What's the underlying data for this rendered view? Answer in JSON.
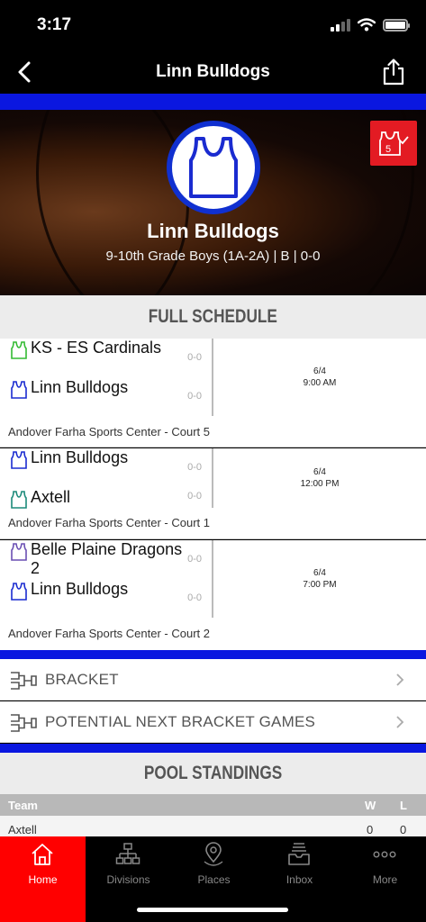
{
  "status_bar": {
    "time": "3:17"
  },
  "nav": {
    "title": "Linn Bulldogs"
  },
  "team": {
    "name": "Linn Bulldogs",
    "subtitle": "9-10th Grade Boys (1A-2A) | B | 0-0"
  },
  "colors": {
    "accent_blue": "#0a17e0",
    "brand_red": "#e31b23",
    "tab_active": "#ff0000"
  },
  "schedule": {
    "title": "FULL SCHEDULE",
    "games": [
      {
        "team1": {
          "name": "KS - ES Cardinals",
          "score": "0-0",
          "icon_color": "#33bb33"
        },
        "team2": {
          "name": "Linn Bulldogs",
          "score": "0-0",
          "icon_color": "#1a2bd0"
        },
        "date": "6/4",
        "time": "9:00 AM",
        "venue": "Andover Farha Sports Center - Court 5"
      },
      {
        "team1": {
          "name": "Linn Bulldogs",
          "score": "0-0",
          "icon_color": "#1a2bd0"
        },
        "team2": {
          "name": "Axtell",
          "score": "0-0",
          "icon_color": "#1c8a7a"
        },
        "date": "6/4",
        "time": "12:00 PM",
        "venue": "Andover Farha Sports Center - Court 1"
      },
      {
        "team1": {
          "name": "Belle Plaine Dragons 2",
          "score": "0-0",
          "icon_color": "#6a4fb3"
        },
        "team2": {
          "name": "Linn Bulldogs",
          "score": "0-0",
          "icon_color": "#1a2bd0"
        },
        "date": "6/4",
        "time": "7:00 PM",
        "venue": "Andover Farha Sports Center - Court 2"
      }
    ]
  },
  "links": {
    "bracket": "BRACKET",
    "potential": "POTENTIAL NEXT BRACKET GAMES"
  },
  "standings": {
    "title": "POOL STANDINGS",
    "columns": {
      "team": "Team",
      "w": "W",
      "l": "L"
    },
    "rows": [
      {
        "team": "Axtell",
        "w": "0",
        "l": "0"
      }
    ]
  },
  "tabs": [
    {
      "label": "Home",
      "icon": "home-icon"
    },
    {
      "label": "Divisions",
      "icon": "divisions-icon"
    },
    {
      "label": "Places",
      "icon": "map-pin-icon"
    },
    {
      "label": "Inbox",
      "icon": "inbox-icon"
    },
    {
      "label": "More",
      "icon": "more-icon"
    }
  ]
}
